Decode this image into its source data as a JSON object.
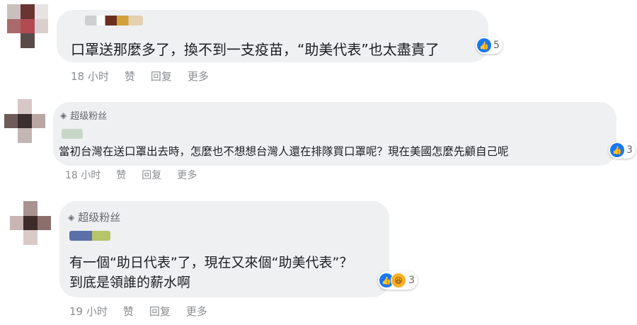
{
  "comments": [
    {
      "text": "口罩送那麼多了，換不到一支疫苗，“助美代表”也太盡責了",
      "reactions": {
        "count": "5",
        "icons": [
          "like-icon"
        ]
      },
      "actions": {
        "time": "18 小时",
        "like": "赞",
        "reply": "回复",
        "more": "更多"
      }
    },
    {
      "badge": "超级粉丝",
      "text": "當初台灣在送口罩出去時，怎麼也不想想台灣人還在排隊買口罩呢？現在美國怎麼先顧自己呢",
      "reactions": {
        "count": "3",
        "icons": [
          "like-icon"
        ]
      },
      "actions": {
        "time": "18 小时",
        "like": "赞",
        "reply": "回复",
        "more": "更多"
      }
    },
    {
      "badge": "超级粉丝",
      "text_line1": "有一個“助日代表”了，現在又來個“助美代表”？",
      "text_line2": "到底是領誰的薪水啊",
      "reactions": {
        "count": "3",
        "icons": [
          "like-icon",
          "haha-icon"
        ]
      },
      "actions": {
        "time": "19 小时",
        "like": "赞",
        "reply": "回复",
        "more": "更多"
      }
    }
  ],
  "colors": {
    "bubble": "#eef0f2",
    "like": "#1877f2",
    "haha": "#f7b125",
    "meta": "#8a8d91"
  }
}
